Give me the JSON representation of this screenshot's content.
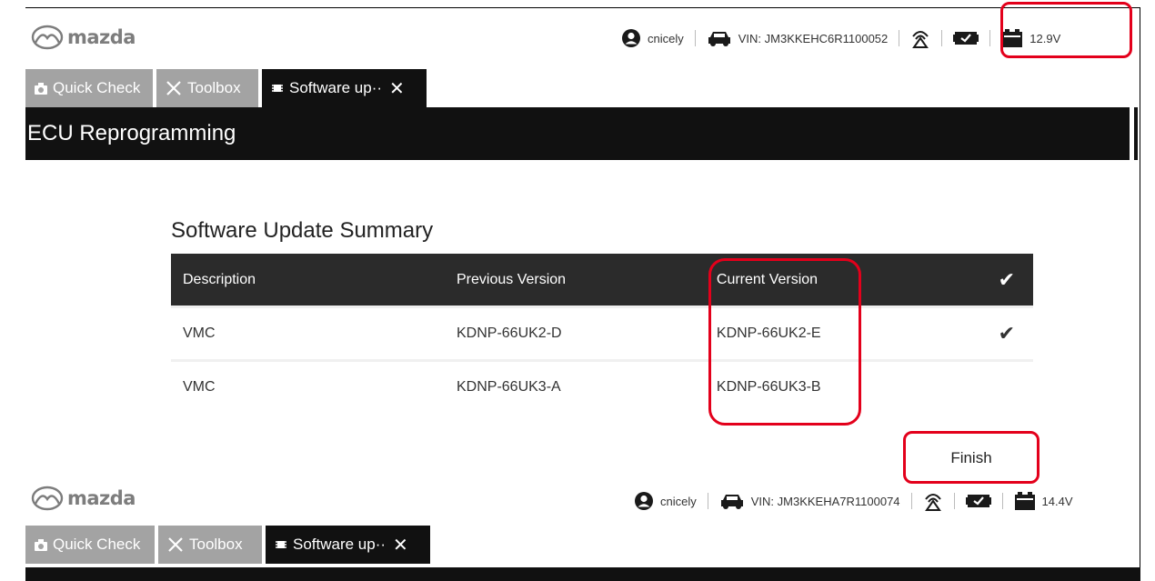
{
  "brand": {
    "name": "mazda",
    "logo_color": "#7d7d7d"
  },
  "colors": {
    "highlight": "#e3001b",
    "tab_active": "#111111",
    "tab_inactive": "#a3a3a3",
    "header": "#2b2b2b"
  },
  "top_screen": {
    "status": {
      "user": "cnicely",
      "vin": "VIN: JM3KKEHC6R1100052",
      "voltage": "12.9V"
    },
    "tabs": [
      {
        "label": "Quick Check",
        "icon": "camera-icon"
      },
      {
        "label": "Toolbox",
        "icon": "tools-icon"
      },
      {
        "label": "Software up··",
        "icon": "chip-icon",
        "active": true
      }
    ]
  },
  "page_title": "ECU Reprogramming",
  "summary": {
    "title": "Software Update Summary",
    "columns": [
      "Description",
      "Previous Version",
      "Current Version"
    ],
    "header_check": "✔",
    "rows": [
      {
        "description": "VMC",
        "previous": "KDNP-66UK2-D",
        "current": "KDNP-66UK2-E",
        "check": "✔"
      },
      {
        "description": "VMC",
        "previous": "KDNP-66UK3-A",
        "current": "KDNP-66UK3-B",
        "check": ""
      }
    ]
  },
  "finish_label": "Finish",
  "bottom_screen": {
    "status": {
      "user": "cnicely",
      "vin": "VIN: JM3KKEHA7R1100074",
      "voltage": "14.4V"
    },
    "tabs": [
      {
        "label": "Quick Check",
        "icon": "camera-icon"
      },
      {
        "label": "Toolbox",
        "icon": "tools-icon"
      },
      {
        "label": "Software up··",
        "icon": "chip-icon",
        "active": true
      }
    ]
  }
}
